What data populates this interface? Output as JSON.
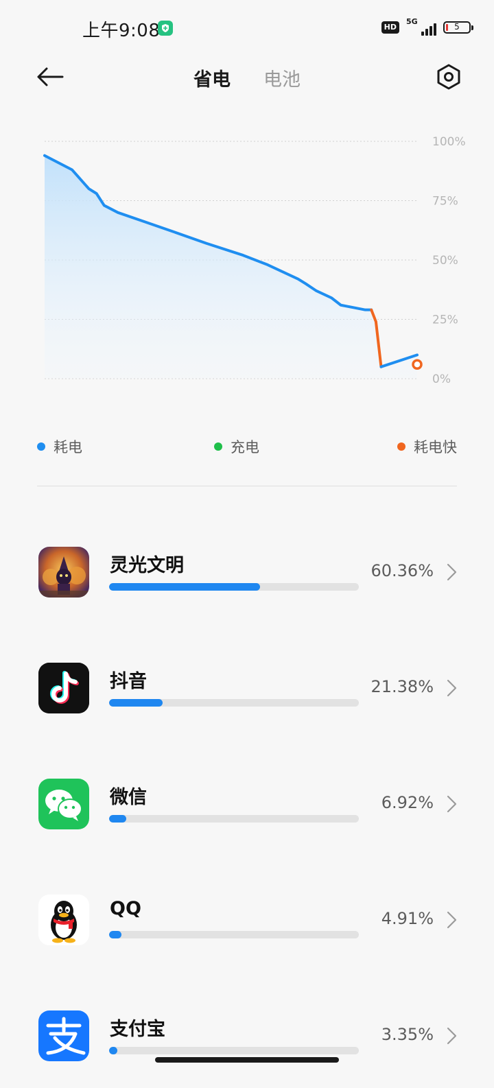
{
  "status_bar": {
    "time": "上午9:08",
    "hd": "HD",
    "network": "5G",
    "battery_level": "5"
  },
  "header": {
    "tabs": [
      {
        "label": "省电",
        "active": true
      },
      {
        "label": "电池",
        "active": false
      }
    ],
    "back_icon": "arrow-left-icon",
    "settings_icon": "gear-icon"
  },
  "chart_data": {
    "type": "area",
    "y_ticks": [
      "100%",
      "75%",
      "50%",
      "25%",
      "0%"
    ],
    "ylim": [
      0,
      100
    ],
    "grid": true,
    "series": [
      {
        "name": "耗电",
        "color": "#1f8ef0",
        "x": [
          0,
          4.5,
          9,
          14.5,
          17,
          19.5,
          24,
          33,
          42,
          53,
          65,
          73,
          83,
          85.5,
          89,
          94,
          97,
          101,
          105,
          107
        ],
        "y": [
          94,
          91,
          88,
          80,
          78,
          73,
          70,
          66,
          62,
          57,
          52,
          48,
          42,
          40,
          37,
          34,
          31,
          30,
          29,
          29
        ]
      },
      {
        "name": "耗电快",
        "color": "#f0661f",
        "x": [
          107,
          108.5,
          110.2
        ],
        "y": [
          29,
          24,
          5
        ]
      },
      {
        "name": "耗电",
        "color": "#1f8ef0",
        "x": [
          110.2,
          122
        ],
        "y": [
          5,
          10
        ]
      }
    ],
    "end_marker": {
      "x": 122,
      "y": 6,
      "color": "#f0661f"
    }
  },
  "legend": [
    {
      "label": "耗电",
      "color": "#1f8ef0"
    },
    {
      "label": "充电",
      "color": "#1fbf4a"
    },
    {
      "label": "耗电快",
      "color": "#f0661f"
    }
  ],
  "apps": [
    {
      "name": "灵光文明",
      "percent": "60.36%",
      "fraction": 0.6036,
      "icon": "game-character-icon"
    },
    {
      "name": "抖音",
      "percent": "21.38%",
      "fraction": 0.2138,
      "icon": "tiktok-note-icon"
    },
    {
      "name": "微信",
      "percent": "6.92%",
      "fraction": 0.0692,
      "icon": "wechat-bubbles-icon"
    },
    {
      "name": "QQ",
      "percent": "4.91%",
      "fraction": 0.0491,
      "icon": "qq-penguin-icon"
    },
    {
      "name": "支付宝",
      "percent": "3.35%",
      "fraction": 0.0335,
      "icon": "alipay-icon"
    }
  ]
}
